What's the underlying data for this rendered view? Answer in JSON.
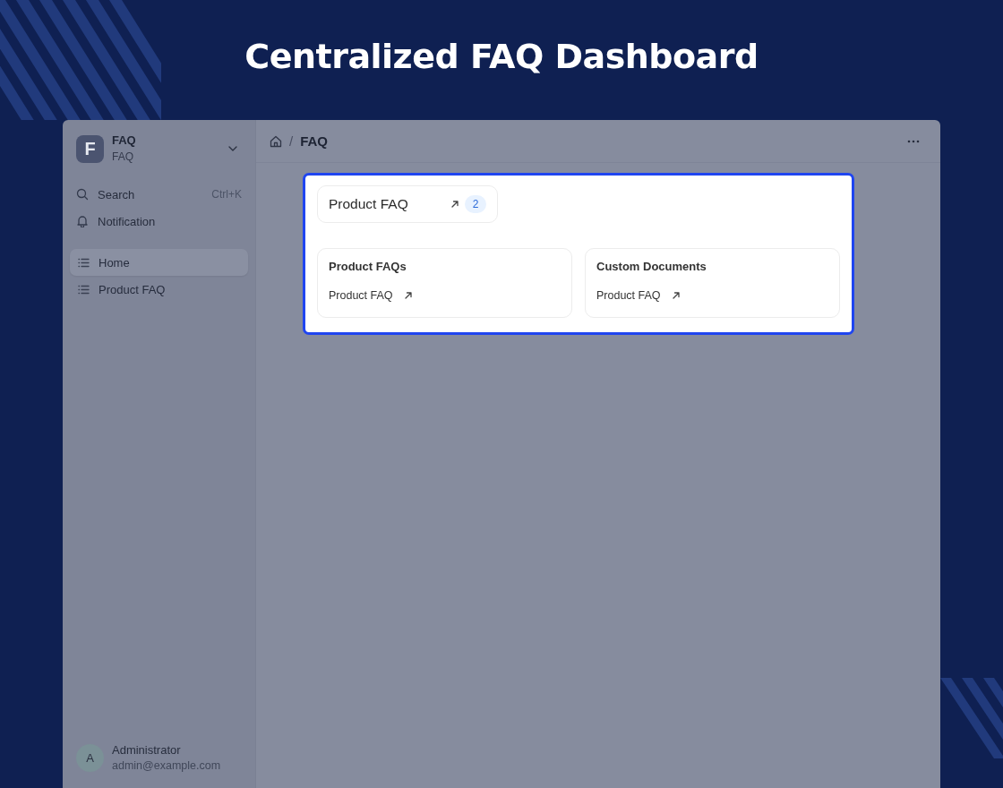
{
  "page_title": "Centralized FAQ Dashboard",
  "workspace": {
    "initial": "F",
    "name": "FAQ",
    "subtitle": "FAQ"
  },
  "sidebar": {
    "actions": [
      {
        "kind": "search",
        "label": "Search",
        "shortcut": "Ctrl+K"
      },
      {
        "kind": "notification",
        "label": "Notification"
      }
    ],
    "items": [
      {
        "label": "Home",
        "selected": true
      },
      {
        "label": "Product FAQ",
        "selected": false
      }
    ]
  },
  "user": {
    "initial": "A",
    "name": "Administrator",
    "email": "admin@example.com"
  },
  "breadcrumb": [
    {
      "separator": "/",
      "label": "FAQ"
    }
  ],
  "shortcut_card": {
    "label": "Product FAQ",
    "count": "2"
  },
  "cards": [
    {
      "title": "Product FAQs",
      "links": [
        "Product FAQ"
      ]
    },
    {
      "title": "Custom Documents",
      "links": [
        "Product FAQ"
      ]
    }
  ]
}
